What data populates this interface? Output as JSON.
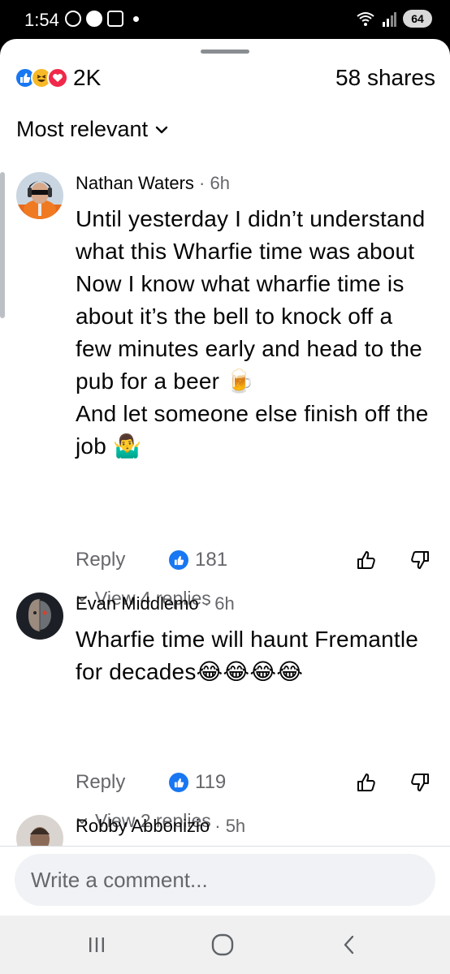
{
  "status_bar": {
    "time": "1:54",
    "battery": "64"
  },
  "header": {
    "reaction_count": "2K",
    "shares": "58 shares"
  },
  "sort": {
    "label": "Most relevant"
  },
  "comments": [
    {
      "author": "Nathan Waters",
      "time": "· 6h",
      "text": "Until yesterday I didn’t understand what this Wharfie time was about Now I know what wharfie time is about  it’s the bell to knock off a few minutes early and head to the pub  for a beer 🍺\nAnd let someone else  finish off the job 🤷‍♂️",
      "reply_label": "Reply",
      "likes": "181",
      "view_replies": "View 4 replies"
    },
    {
      "author": "Evan Middlemo",
      "time": "· 6h",
      "text": "Wharfie time  will haunt Fremantle for decades😂😂😂😂",
      "reply_label": "Reply",
      "likes": "119",
      "view_replies": "View 2 replies"
    },
    {
      "author": "Robby Abbonizio",
      "time": "· 5h"
    }
  ],
  "composer": {
    "placeholder": "Write a comment..."
  },
  "colors": {
    "accent": "#1877f2",
    "secondary_text": "#65676b",
    "composer_bg": "#f0f2f5"
  }
}
